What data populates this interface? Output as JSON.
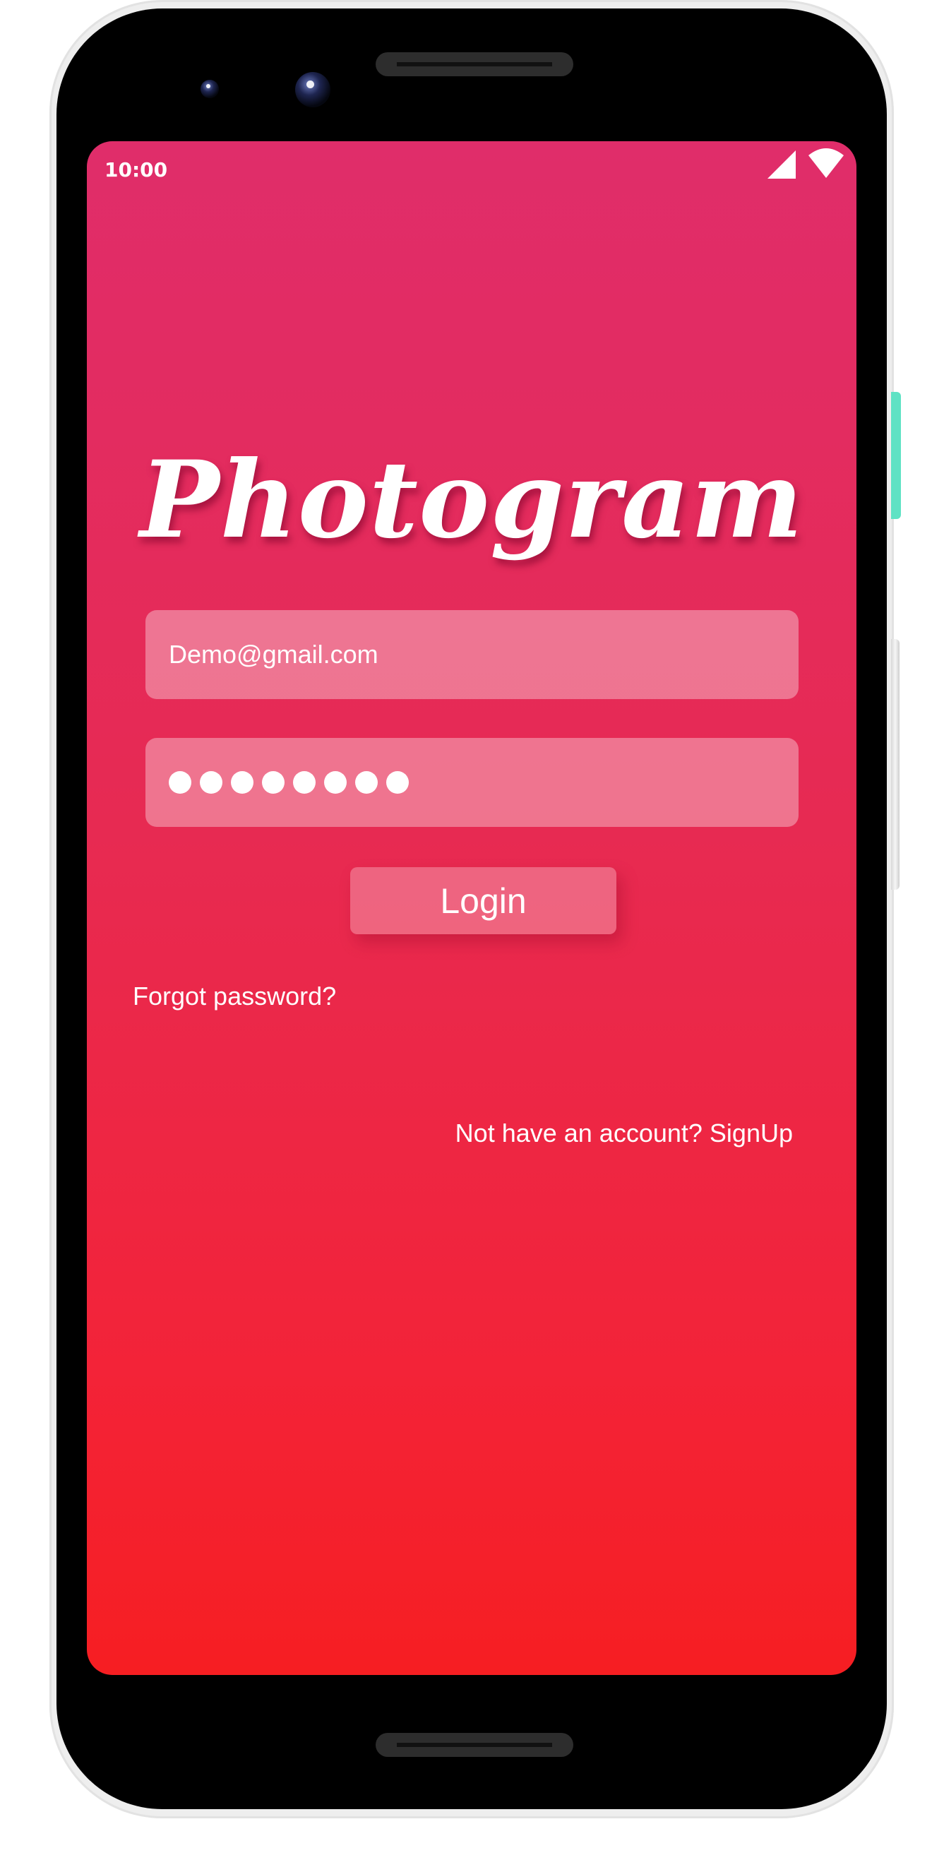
{
  "status_bar": {
    "time": "10:00",
    "signal_icon": "cellular-signal-icon",
    "wifi_icon": "wifi-icon"
  },
  "app": {
    "name": "Photogram"
  },
  "login_form": {
    "email_value": "Demo@gmail.com",
    "password_mask_length": 8,
    "login_label": "Login",
    "forgot_password_label": "Forgot password?",
    "signup_label": "Not have an account? SignUp"
  },
  "colors": {
    "gradient_top": "#e02d6a",
    "gradient_bottom": "#f61e22",
    "text": "#ffffff"
  }
}
